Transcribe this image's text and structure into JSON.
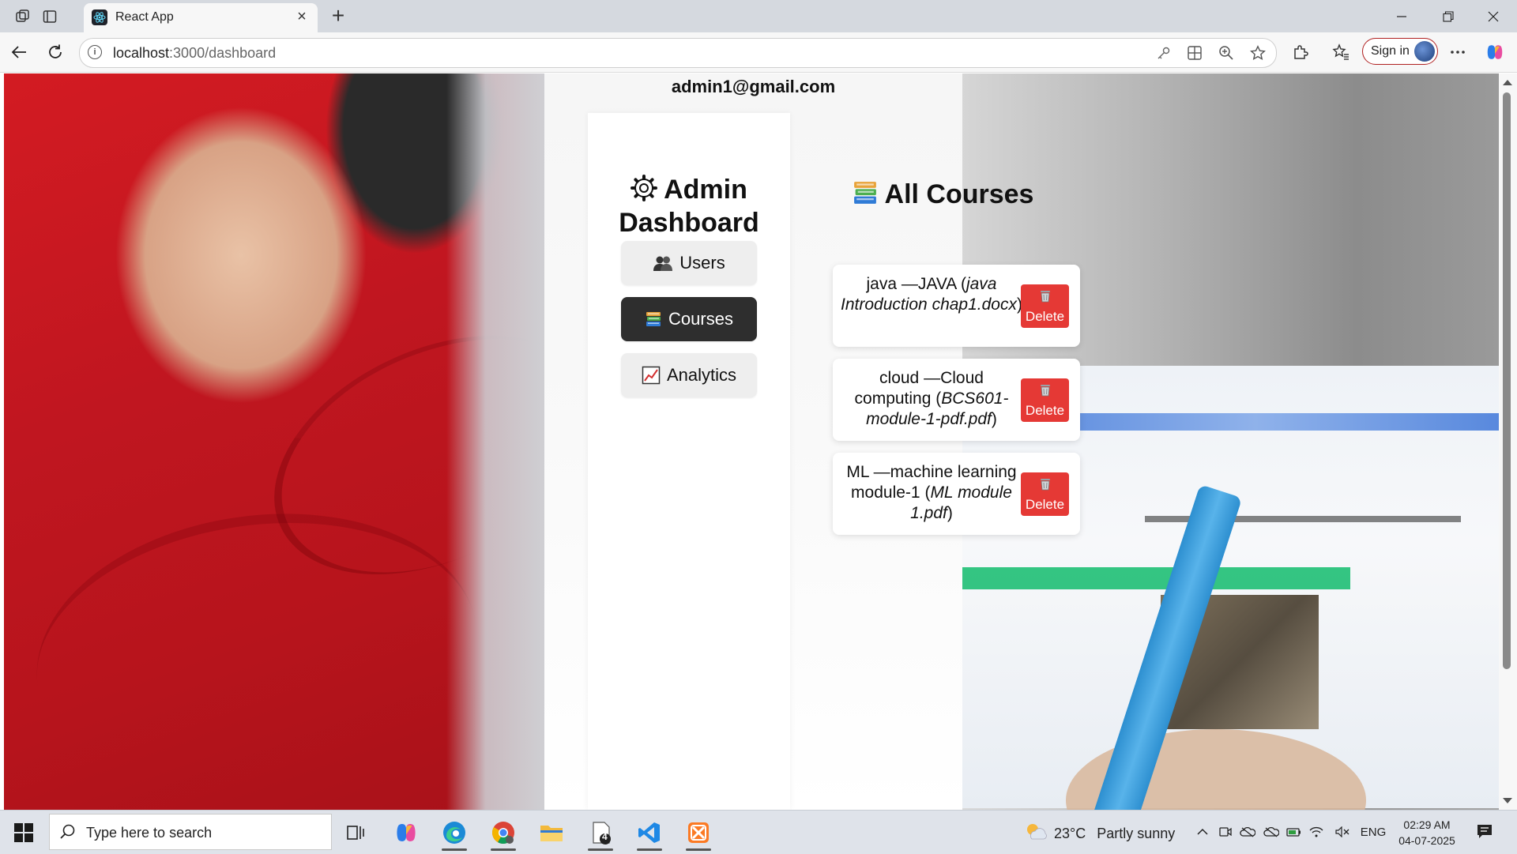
{
  "browser": {
    "tab_title": "React App",
    "url_host": "localhost",
    "url_rest": ":3000/dashboard",
    "signin_label": "Sign in"
  },
  "page": {
    "user_email": "admin1@gmail.com",
    "sidebar": {
      "title": "Admin Dashboard",
      "items": [
        {
          "label": "Users",
          "icon": "users-icon",
          "active": false
        },
        {
          "label": "Courses",
          "icon": "books-icon",
          "active": true
        },
        {
          "label": "Analytics",
          "icon": "chart-icon",
          "active": false
        }
      ]
    },
    "main": {
      "title": "All Courses",
      "courses": [
        {
          "code": "java",
          "name": "JAVA",
          "file": "java Introduction chap1.docx"
        },
        {
          "code": "cloud",
          "name": "Cloud computing",
          "file": "BCS601-module-1-pdf.pdf"
        },
        {
          "code": "ML",
          "name": "machine learning module-1",
          "file": "ML module 1.pdf"
        }
      ],
      "delete_label": "Delete"
    }
  },
  "taskbar": {
    "search_placeholder": "Type here to search",
    "weather_temp": "23°C",
    "weather_text": "Partly sunny",
    "language": "ENG",
    "time": "02:29 AM",
    "date": "04-07-2025",
    "notepad_badge": "4"
  },
  "colors": {
    "delete_red": "#e53935",
    "active_item": "#2e2e2e",
    "signin_border": "#b02020"
  }
}
